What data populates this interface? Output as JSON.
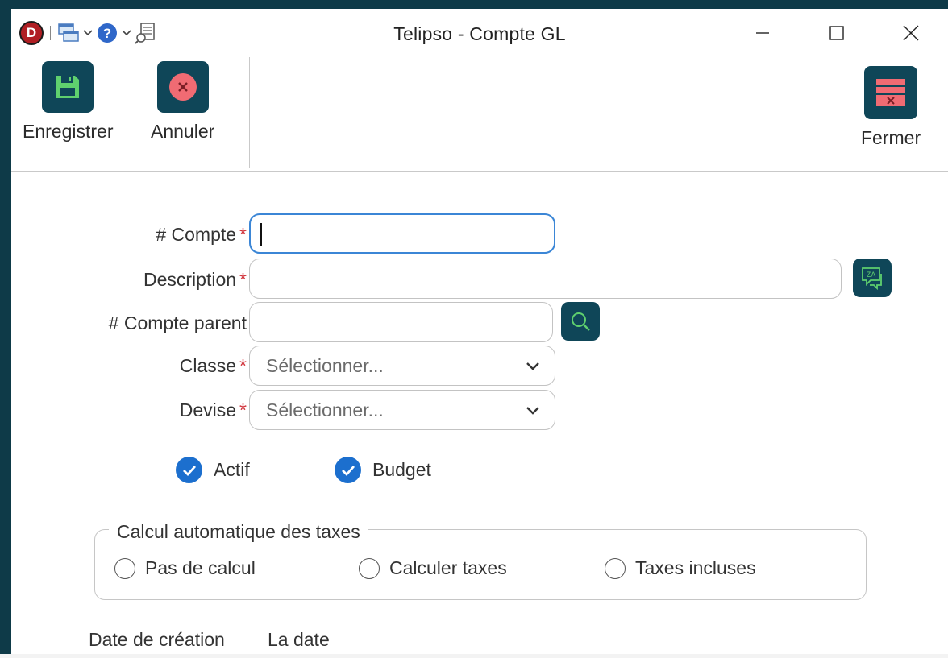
{
  "window": {
    "title": "Telipso - Compte GL",
    "logo_letter": "D",
    "frame_color": "#0e3a48"
  },
  "ribbon": {
    "save_label": "Enregistrer",
    "cancel_label": "Annuler",
    "close_label": "Fermer",
    "tile_color": "#0f4658"
  },
  "form": {
    "account": {
      "label": "# Compte",
      "required_mark": "*",
      "value": ""
    },
    "description": {
      "label": "Description",
      "required_mark": "*",
      "value": ""
    },
    "parent_account": {
      "label": "# Compte parent",
      "value": ""
    },
    "class": {
      "label": "Classe",
      "required_mark": "*",
      "selected": "Sélectionner..."
    },
    "currency": {
      "label": "Devise",
      "required_mark": "*",
      "selected": "Sélectionner..."
    },
    "active": {
      "label": "Actif",
      "checked": true
    },
    "budget": {
      "label": "Budget",
      "checked": true
    }
  },
  "taxes": {
    "legend": "Calcul automatique des taxes",
    "options": [
      "Pas de calcul",
      "Calculer taxes",
      "Taxes incluses"
    ]
  },
  "footer": {
    "created_label": "Date de création",
    "created_value": "La date"
  },
  "colors": {
    "accent": "#1c6fce",
    "required": "#d1343c",
    "focus": "#3b86d6"
  }
}
